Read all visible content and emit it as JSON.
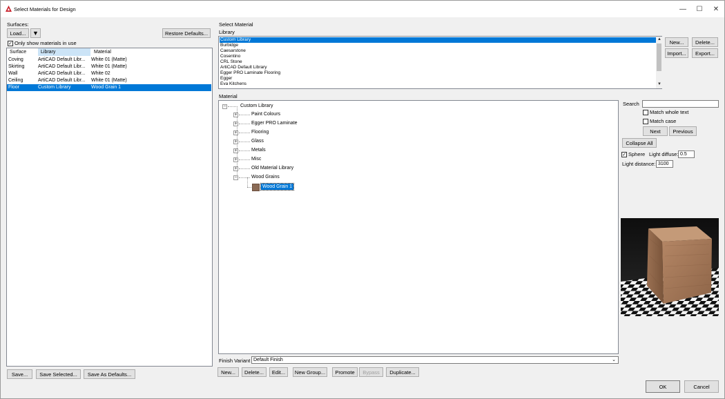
{
  "window": {
    "title": "Select Materials for Design",
    "minimize_glyph": "—",
    "maximize_glyph": "☐",
    "close_glyph": "✕"
  },
  "surfaces": {
    "label": "Surfaces:",
    "load_label": "Load...",
    "load_dropdown_glyph": "▼",
    "restore_label": "Restore Defaults...",
    "only_show_label": "Only show materials in use",
    "only_show_checked": true,
    "columns": [
      "Surface",
      "Library",
      "Material"
    ],
    "rows": [
      {
        "surface": "Coving",
        "library": "ArtiCAD Default Libr...",
        "material": "White 01 (Matte)"
      },
      {
        "surface": "Skirting",
        "library": "ArtiCAD Default Libr...",
        "material": "White 01 (Matte)"
      },
      {
        "surface": "Wall",
        "library": "ArtiCAD Default Libr...",
        "material": "White 02"
      },
      {
        "surface": "Ceiling",
        "library": "ArtiCAD Default Libr...",
        "material": "White 01 (Matte)"
      },
      {
        "surface": "Floor",
        "library": "Custom Library",
        "material": "Wood Grain 1"
      }
    ],
    "selected_row": 4,
    "bottom_buttons": [
      "Save...",
      "Save Selected...",
      "Save As Defaults..."
    ]
  },
  "select_material": {
    "section_label": "Select Material",
    "library_label": "Library",
    "libraries": [
      "Custom Library",
      "Burbidge",
      "Caesarstone",
      "Cosentino",
      "CRL Stone",
      "ArtiCAD Default Library",
      "Egger PRO Laminate Flooring",
      "Egger",
      "Eva Kitchens"
    ],
    "selected_library": 0,
    "library_buttons": {
      "new": "New...",
      "delete": "Delete...",
      "import": "Import...",
      "export": "Export..."
    },
    "material_label": "Material",
    "tree": {
      "root": "Custom Library",
      "groups": [
        "Paint Colours",
        "Egger PRO Laminate",
        "Flooring",
        "Glass",
        "Metals",
        "Misc",
        "Old Material Library",
        "Wood Grains"
      ],
      "expanded_group": "Wood Grains",
      "selected_item": "Wood Grain 1"
    },
    "expand_glyph": "⊞",
    "collapse_glyph": "⊟",
    "finish_variant_label": "Finish Variant",
    "finish_variant_value": "Default Finish",
    "bottom_buttons": {
      "new": "New...",
      "delete": "Delete...",
      "edit": "Edit...",
      "new_group": "New Group...",
      "promote": "Promote",
      "bypass": "Bypass",
      "duplicate": "Duplicate..."
    }
  },
  "search_panel": {
    "search_label": "Search",
    "search_value": "",
    "match_whole_label": "Match whole text",
    "match_whole_checked": false,
    "match_case_label": "Match case",
    "match_case_checked": false,
    "next_label": "Next",
    "previous_label": "Previous",
    "collapse_all_label": "Collapse All",
    "sphere_label": "Sphere",
    "sphere_checked": true,
    "light_diffuse_label": "Light diffuse:",
    "light_diffuse_value": "0.5",
    "light_distance_label": "Light distance:",
    "light_distance_value": "3100"
  },
  "dialog_buttons": {
    "ok": "OK",
    "cancel": "Cancel"
  },
  "colors": {
    "selection": "#0078d7",
    "swatch": "#8a6a55",
    "wood": "#a47a5a"
  }
}
